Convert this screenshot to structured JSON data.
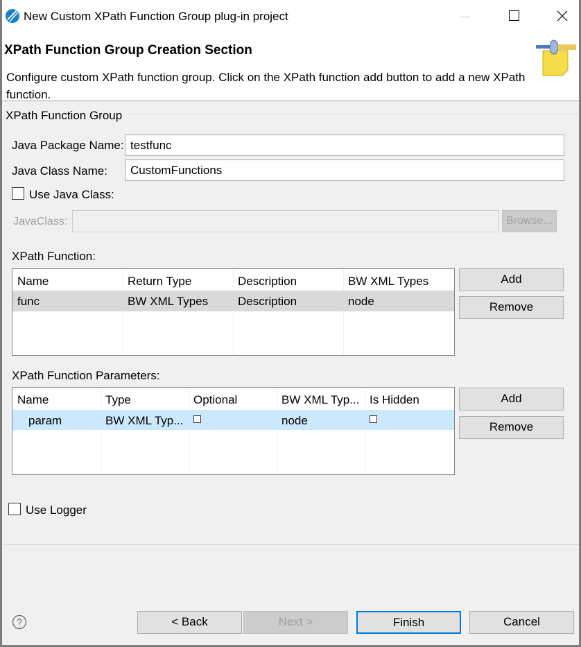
{
  "window": {
    "title": "New Custom XPath Function Group plug-in project"
  },
  "header": {
    "title": "XPath Function Group Creation Section",
    "description": "Configure custom XPath function group. Click on the XPath function add button to add a new XPath function."
  },
  "group": {
    "label": "XPath Function Group",
    "package_label": "Java Package Name:",
    "package_value": "testfunc",
    "class_label": "Java Class Name:",
    "class_value": "CustomFunctions",
    "use_java_class_label": "Use Java Class:",
    "use_java_class_checked": false,
    "java_class_label": "JavaClass:",
    "java_class_value": "",
    "browse_label": "Browse..."
  },
  "functions": {
    "label": "XPath Function:",
    "columns": [
      "Name",
      "Return Type",
      "Description",
      "BW XML Types"
    ],
    "rows": [
      [
        "func",
        "BW XML Types",
        "Description",
        "node"
      ]
    ],
    "add_label": "Add",
    "remove_label": "Remove"
  },
  "params": {
    "label": "XPath Function Parameters:",
    "columns": [
      "Name",
      "Type",
      "Optional",
      "BW XML Typ...",
      "Is Hidden"
    ],
    "rows": [
      {
        "name": "param",
        "type": "BW XML Typ...",
        "optional": false,
        "bw_type": "node",
        "hidden": false
      }
    ],
    "add_label": "Add",
    "remove_label": "Remove"
  },
  "logger": {
    "label": "Use Logger",
    "checked": false
  },
  "footer": {
    "back": "< Back",
    "next": "Next >",
    "finish": "Finish",
    "cancel": "Cancel"
  }
}
